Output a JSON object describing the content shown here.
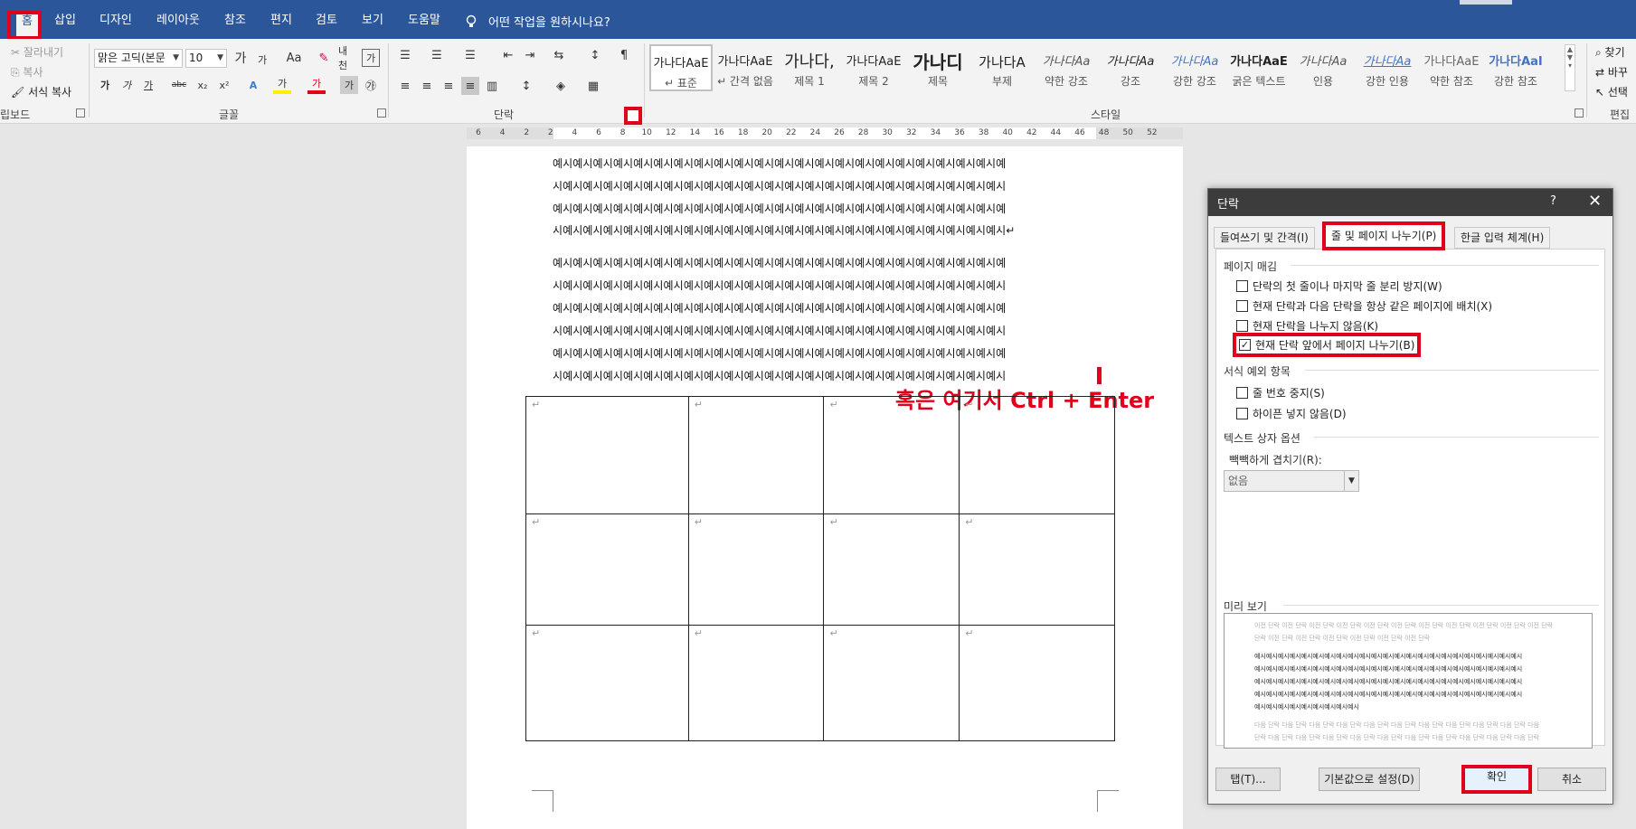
{
  "tabs": [
    {
      "label": "홈"
    },
    {
      "label": "삽입"
    },
    {
      "label": "디자인"
    },
    {
      "label": "레이아웃"
    },
    {
      "label": "참조"
    },
    {
      "label": "편지"
    },
    {
      "label": "검토"
    },
    {
      "label": "보기"
    },
    {
      "label": "도움말"
    }
  ],
  "tell_me": "어떤 작업을 원하시나요?",
  "clipboard": {
    "cut": "잘라내기",
    "copy": "복사",
    "format_painter": "서식 복사",
    "group": "립보드"
  },
  "font": {
    "name": "맑은 고딕(본문",
    "size": "10",
    "group": "글꼴",
    "inc": "가",
    "dec": "가",
    "case": "Aa",
    "phonetic": "내천",
    "border_char": "가"
  },
  "paragraph": {
    "group": "단락"
  },
  "styles": {
    "group": "스타일",
    "items": [
      {
        "sample": "가나다AaE",
        "name": "↵ 표준"
      },
      {
        "sample": "가나다AaE",
        "name": "↵ 간격 없음"
      },
      {
        "sample": "가나다,",
        "name": "제목 1"
      },
      {
        "sample": "가나다AaE",
        "name": "제목 2"
      },
      {
        "sample": "가나디",
        "name": "제목"
      },
      {
        "sample": "가나다A",
        "name": "부제"
      },
      {
        "sample": "가나다Aa",
        "name": "약한 강조"
      },
      {
        "sample": "가나다Aa",
        "name": "강조"
      },
      {
        "sample": "가나다Aa",
        "name": "강한 강조"
      },
      {
        "sample": "가나다AaE",
        "name": "굵은 텍스트"
      },
      {
        "sample": "가나다Aa",
        "name": "인용"
      },
      {
        "sample": "가나다Aa",
        "name": "강한 인용"
      },
      {
        "sample": "가나다AaE",
        "name": "약한 참조"
      },
      {
        "sample": "가나다AaI",
        "name": "강한 참조"
      }
    ]
  },
  "editing": {
    "find": "찾기",
    "replace": "바꾸",
    "select": "선택",
    "group": "편집"
  },
  "ruler": [
    "6",
    "4",
    "2",
    "2",
    "4",
    "6",
    "8",
    "10",
    "12",
    "14",
    "16",
    "18",
    "20",
    "22",
    "24",
    "26",
    "28",
    "30",
    "32",
    "34",
    "36",
    "38",
    "40",
    "42",
    "44",
    "46",
    "48",
    "50",
    "52"
  ],
  "document": {
    "para1": [
      "예시예시예시예시예시예시예시예시예시예시예시예시예시예시예시예시예시예시예시예시예시예시예",
      "시예시예시예시예시예시예시예시예시예시예시예시예시예시예시예시예시예시예시예시예시예시예시",
      "예시예시예시예시예시예시예시예시예시예시예시예시예시예시예시예시예시예시예시예시예시예시예",
      "시예시예시예시예시예시예시예시예시예시예시예시예시예시예시예시예시예시예시예시예시예시예시↵"
    ],
    "para2": [
      "예시예시예시예시예시예시예시예시예시예시예시예시예시예시예시예시예시예시예시예시예시예시예",
      "시예시예시예시예시예시예시예시예시예시예시예시예시예시예시예시예시예시예시예시예시예시예시",
      "예시예시예시예시예시예시예시예시예시예시예시예시예시예시예시예시예시예시예시예시예시예시예",
      "시예시예시예시예시예시예시예시예시예시예시예시예시예시예시예시예시예시예시예시예시예시예시",
      "예시예시예시예시예시예시예시예시예시예시예시예시예시예시예시예시예시예시예시예시예시예시예",
      "시예시예시예시예시예시예시예시예시예시예시예시예시예시예시예시예시예시예시예시예시예시예시"
    ],
    "annotation": "혹은 여기서 Ctrl + Enter",
    "cell_mark": "↵"
  },
  "dialog": {
    "title": "단락",
    "help": "?",
    "close": "✕",
    "tabs": [
      "들여쓰기 및 간격(I)",
      "줄 및 페이지 나누기(P)",
      "한글 입력 체계(H)"
    ],
    "pagination_label": "페이지 매김",
    "pagination": [
      {
        "label": "단락의 첫 줄이나 마지막 줄 분리 방지(W)",
        "checked": false
      },
      {
        "label": "현재 단락과 다음 단락을 항상 같은 페이지에 배치(X)",
        "checked": false
      },
      {
        "label": "현재 단락을 나누지 않음(K)",
        "checked": false
      },
      {
        "label": "현재 단락 앞에서 페이지 나누기(B)",
        "checked": true
      }
    ],
    "exceptions_label": "서식 예외 항목",
    "exceptions": [
      {
        "label": "줄 번호 중지(S)",
        "checked": false
      },
      {
        "label": "하이픈 넣지 않음(D)",
        "checked": false
      }
    ],
    "textbox_label": "텍스트 상자 옵션",
    "tight_wrap_label": "빽빽하게 겹치기(R):",
    "tight_wrap_value": "없음",
    "preview_label": "미리 보기",
    "preview": {
      "prev1": "이전 단락 이전 단락 이전 단락 이전 단락 이전 단락 이전 단락 이전 단락 이전 단락 이전 단락 이전 단락 이전 단락",
      "prev2": "단락 이전 단락 이전 단락 이전 단락 이전 단락 이전 단락 이전 단락",
      "cur1": "예시예시예시예시예시예시예시예시예시예시예시예시예시예시예시예시예시예시예시예시예시예시예시",
      "cur2": "예시예시예시예시예시예시예시예시예시예시예시예시예시예시예시예시예시예시예시예시예시예시예시",
      "cur3": "예시예시예시예시예시예시예시예시예시예시예시예시예시예시예시예시예시예시예시예시예시예시예시",
      "cur4": "예시예시예시예시예시예시예시예시예시예시예시예시예시예시예시예시예시예시예시예시예시예시예시",
      "cur5": "예시예시예시예시예시예시예시예시예시",
      "next1": "다음 단락 다음 단락 다음 단락 다음 단락 다음 단락 다음 단락 다음 단락 다음 단락 다음 단락 다음 단락 다음",
      "next2": "단락 다음 단락 다음 단락 다음 단락 다음 단락 다음 단락 다음 단락 다음 단락 다음 단락 다음 단락 다음 단락"
    },
    "btn_tabs": "탭(T)...",
    "btn_default": "기본값으로 설정(D)",
    "btn_ok": "확인",
    "btn_cancel": "취소"
  },
  "colors": {
    "accent": "#2b579a",
    "highlight": "#e0001b"
  }
}
